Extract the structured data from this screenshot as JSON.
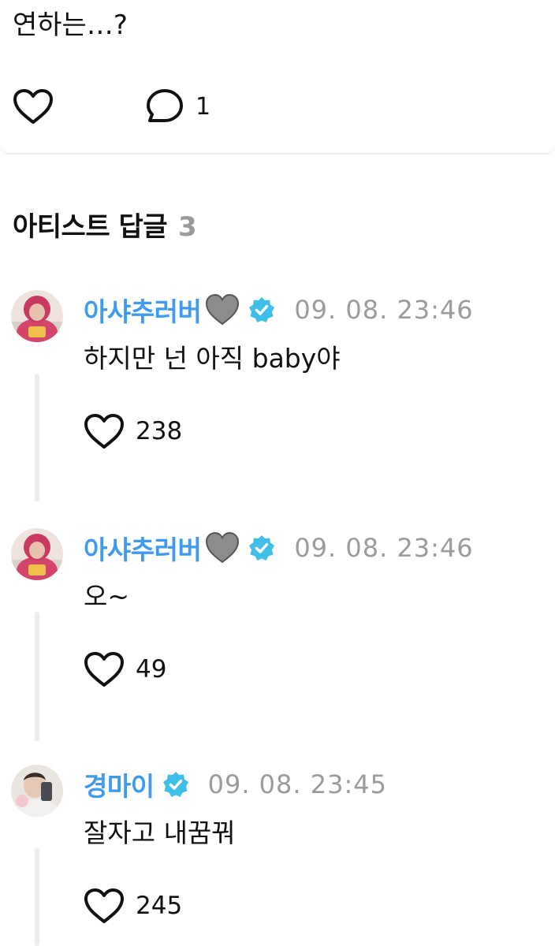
{
  "post": {
    "text": "연하는…?",
    "comment_count": "1"
  },
  "section": {
    "title": "아티스트 답글",
    "count": "3"
  },
  "colors": {
    "author": "#3f9bf0",
    "verified": "#3fbfe8",
    "muted": "#9b9b9b",
    "thread_line": "#ececec"
  },
  "comments": [
    {
      "author": "아샤추러버",
      "author_emoji": "grey-heart-icon",
      "verified": true,
      "timestamp": "09. 08. 23:46",
      "body": "하지만 넌 아직 baby야",
      "likes": "238"
    },
    {
      "author": "아샤추러버",
      "author_emoji": "grey-heart-icon",
      "verified": true,
      "timestamp": "09. 08. 23:46",
      "body": "오~",
      "likes": "49"
    },
    {
      "author": "경마이",
      "author_emoji": "",
      "verified": true,
      "timestamp": "09. 08. 23:45",
      "body": "잘자고 내꿈꿔",
      "likes": "245"
    }
  ]
}
